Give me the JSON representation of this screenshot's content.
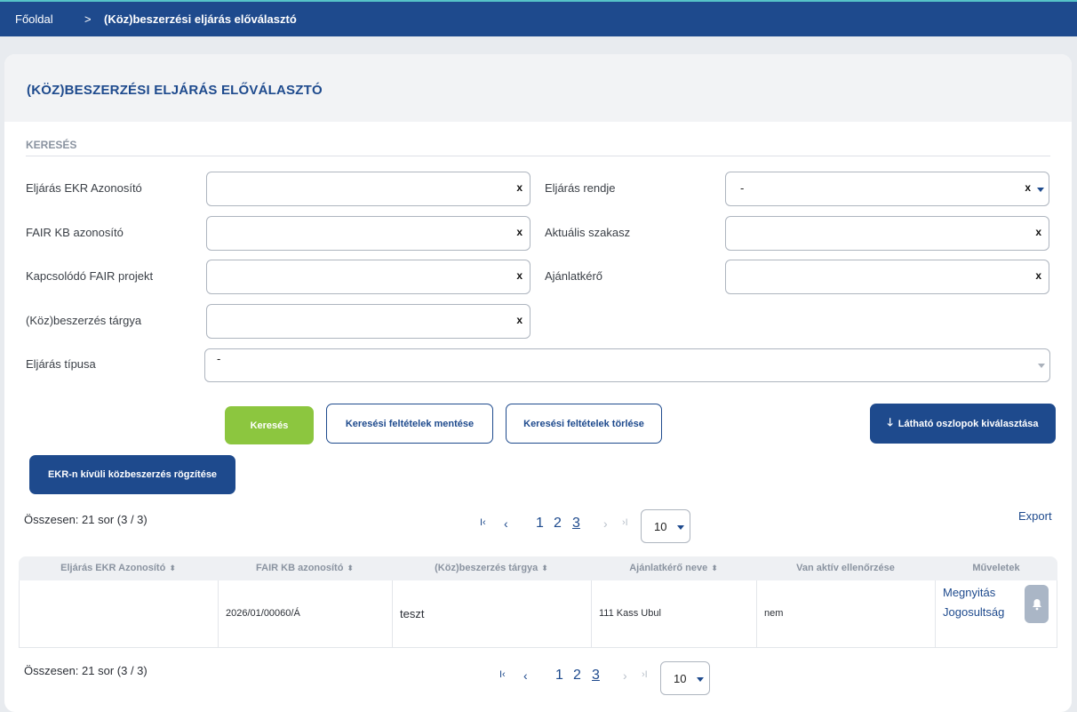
{
  "breadcrumb": {
    "home": "Főoldal",
    "separator": ">",
    "current": "(Köz)beszerzési eljárás előválasztó"
  },
  "page": {
    "title": "(KÖZ)BESZERZÉSI ELJÁRÁS ELŐVÁLASZTÓ",
    "section": "KERESÉS"
  },
  "form": {
    "ekr_id": {
      "label": "Eljárás EKR Azonosító",
      "value": "",
      "clear": "x"
    },
    "fair_kb": {
      "label": "FAIR KB azonosító",
      "value": "",
      "clear": "x"
    },
    "fair_project": {
      "label": "Kapcsolódó FAIR projekt",
      "value": "",
      "clear": "x"
    },
    "subject": {
      "label": "(Köz)beszerzés tárgya",
      "value": "",
      "clear": "x"
    },
    "procedure_order": {
      "label": "Eljárás rendje",
      "value": "-",
      "clear": "x"
    },
    "current_stage": {
      "label": "Aktuális szakasz",
      "value": "",
      "clear": "x"
    },
    "contracting": {
      "label": "Ajánlatkérő",
      "value": "",
      "clear": "x"
    },
    "procedure_type": {
      "label": "Eljárás típusa",
      "value": "-"
    }
  },
  "buttons": {
    "search": "Keresés",
    "save_criteria": "Keresési feltételek mentése",
    "clear_criteria": "Keresési feltételek törlése",
    "visible_columns": "Látható oszlopok kiválasztása",
    "record_outside": "EKR-n kívüli közbeszerzés rögzítése"
  },
  "results": {
    "total": "Összesen: 21 sor (3 / 3)",
    "export": "Export",
    "pager": {
      "first": "K",
      "prev": "‹",
      "next": "›",
      "last": "›I",
      "pages": [
        "1",
        "2",
        "3"
      ],
      "page_size": "10"
    }
  },
  "table": {
    "columns": [
      "Eljárás EKR Azonosító",
      "FAIR KB azonosító",
      "(Köz)beszerzés tárgya",
      "Ajánlatkérő neve",
      "Van aktív ellenőrzése",
      "Műveletek"
    ],
    "rows": [
      {
        "ekr_id": "",
        "fair_kb": "2026/01/00060/Á",
        "subject": "teszt",
        "contracting": "111 Kass Ubul",
        "active_check": "nem",
        "actions": [
          "Megnyitás",
          "Jogosultság"
        ]
      }
    ]
  },
  "icons": {
    "sort": "sort-icon",
    "bell": "bell-icon",
    "arrow": "arrow-down-icon",
    "caret": "caret-down-icon"
  },
  "colors": {
    "primary": "#1e4a8d",
    "accent": "#8cc63f",
    "topbar_line": "#56c3c8"
  }
}
